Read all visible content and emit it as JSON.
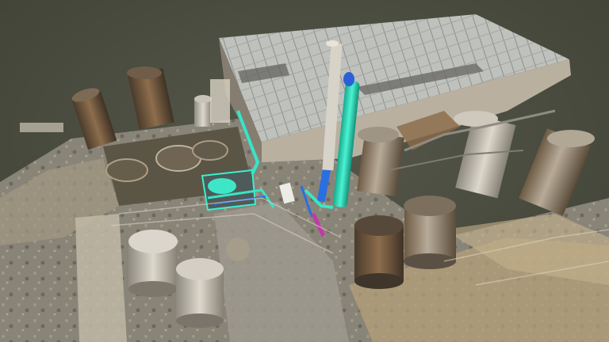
{
  "scene": {
    "subject": "point-cloud-industrial-plant",
    "colors": {
      "background": "#4d4f43",
      "ground": "#8a8478",
      "rust": "#8a6a45",
      "tank_gray": "#a9a49a",
      "roof": "#c4c6c2",
      "highlight_cyan": "#2fe0c0",
      "highlight_blue": "#2a6fe0",
      "highlight_magenta": "#c03aa8"
    }
  }
}
